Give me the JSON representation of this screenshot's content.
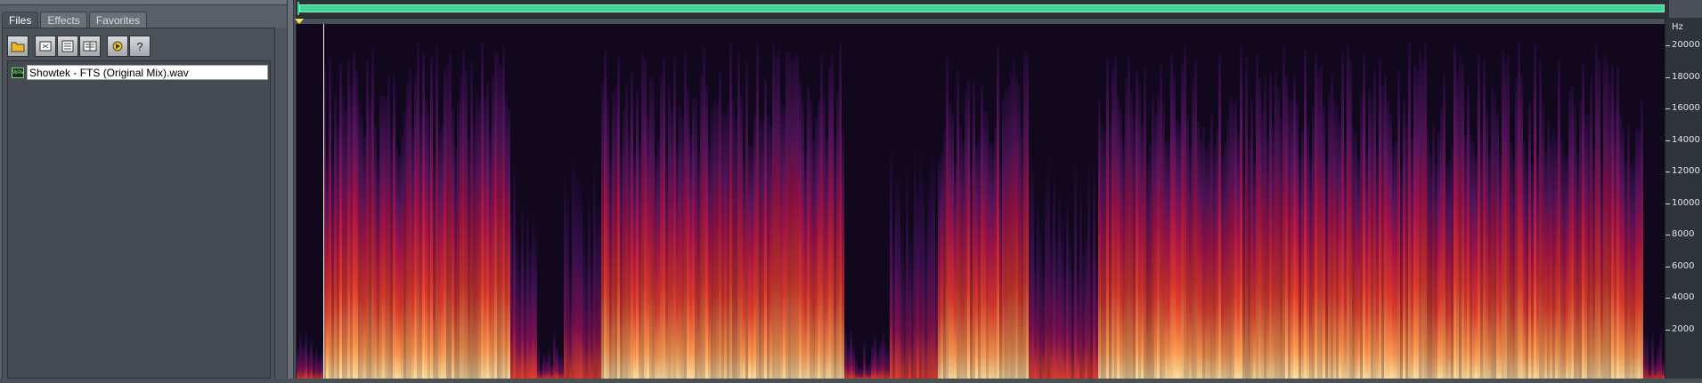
{
  "organizer": {
    "tabs": [
      {
        "label": "Files",
        "active": true
      },
      {
        "label": "Effects",
        "active": false
      },
      {
        "label": "Favorites",
        "active": false
      }
    ],
    "toolbar": [
      {
        "icon": "open-folder-icon"
      },
      {
        "icon": "close-file-icon"
      },
      {
        "icon": "close-all-icon"
      },
      {
        "icon": "insert-multitrack-icon"
      },
      {
        "icon": "auto-play-icon"
      },
      {
        "icon": "help-icon"
      }
    ],
    "files": [
      {
        "name": "Showtek - FTS (Original Mix).wav",
        "selected": true
      }
    ]
  },
  "editor": {
    "view": "spectral",
    "ruler": {
      "unit": "Hz",
      "ticks": [
        "20000",
        "18000",
        "16000",
        "14000",
        "12000",
        "10000",
        "8000",
        "6000",
        "4000",
        "2000"
      ]
    },
    "colors": {
      "overview": "#3fd49a",
      "cursor_marker": "#f2e25a",
      "spectral_low": "#12081e",
      "spectral_mid": "#c4134a",
      "spectral_high": "#ffd27a"
    }
  }
}
